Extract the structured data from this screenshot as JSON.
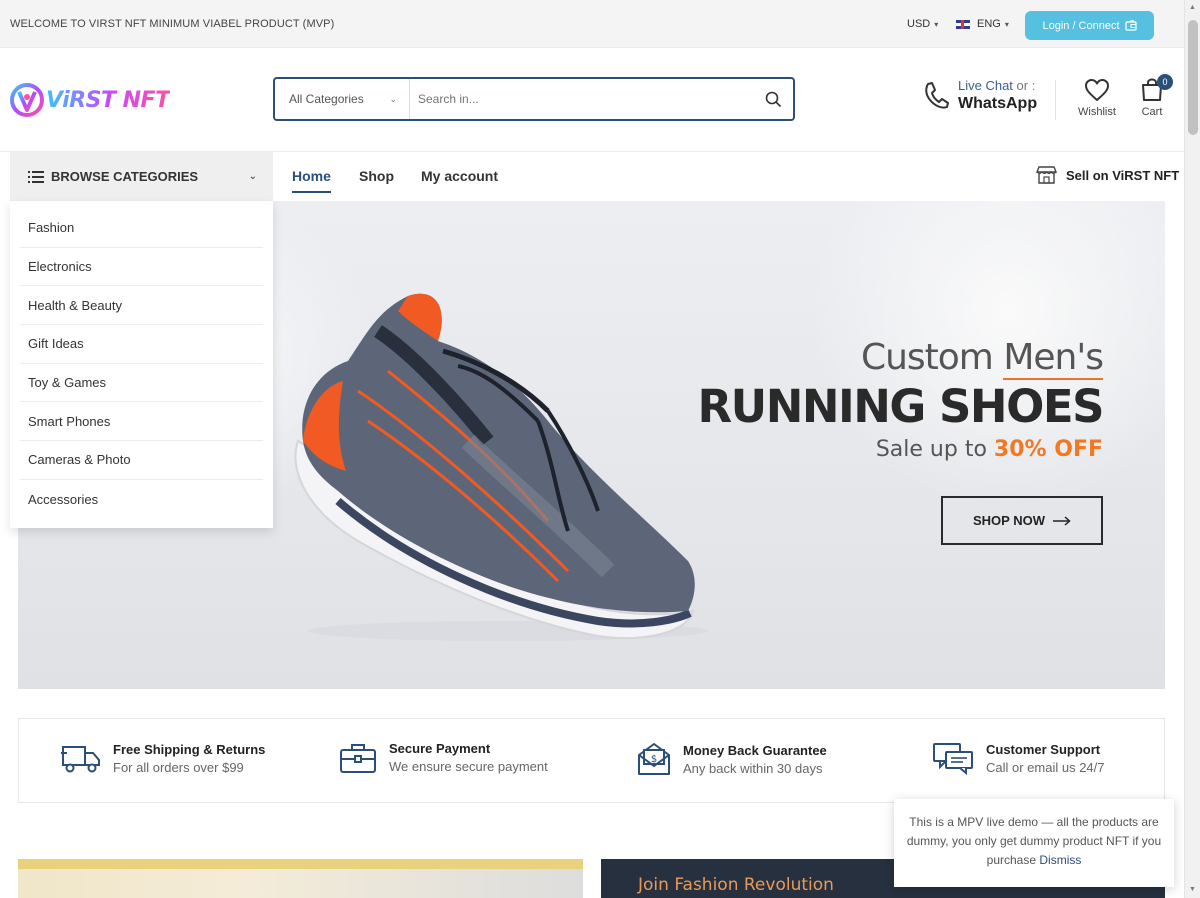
{
  "topbar": {
    "welcome": "WELCOME TO VIRST NFT MINIMUM VIABEL PRODUCT (MVP)",
    "currency": "USD",
    "language": "ENG",
    "login_label": "Login / Connect"
  },
  "header": {
    "logo_text": "ViRST NFT",
    "search": {
      "category": "All Categories",
      "placeholder": "Search in..."
    },
    "live_chat": "Live Chat",
    "or": "or :",
    "whatsapp": "WhatsApp",
    "wishlist_label": "Wishlist",
    "cart_label": "Cart",
    "cart_count": "0"
  },
  "nav": {
    "browse_label": "BROWSE CATEGORIES",
    "links": [
      "Home",
      "Shop",
      "My account"
    ],
    "sell_label": "Sell on ViRST NFT"
  },
  "categories": [
    "Fashion",
    "Electronics",
    "Health & Beauty",
    "Gift Ideas",
    "Toy & Games",
    "Smart Phones",
    "Cameras & Photo",
    "Accessories"
  ],
  "hero": {
    "line1_a": "Custom ",
    "line1_b": "Men's",
    "line2": "RUNNING SHOES",
    "line3_a": "Sale up to ",
    "line3_b": "30% OFF",
    "cta": "SHOP NOW"
  },
  "features": [
    {
      "title": "Free Shipping & Returns",
      "subtitle": "For all orders over $99",
      "icon": "truck-icon"
    },
    {
      "title": "Secure Payment",
      "subtitle": "We ensure secure payment",
      "icon": "briefcase-icon"
    },
    {
      "title": "Money Back Guarantee",
      "subtitle": "Any back within 30 days",
      "icon": "money-envelope-icon"
    },
    {
      "title": "Customer Support",
      "subtitle": "Call or email us 24/7",
      "icon": "chat-icon"
    }
  ],
  "promo": {
    "fashion_title": "Join Fashion Revolution"
  },
  "notice": {
    "text": "This is a MPV live demo — all the products are dummy, you only get dummy product NFT if you purchase",
    "dismiss": "Dismiss"
  },
  "colors": {
    "accent": "#2a4f7a",
    "login": "#56c0e0",
    "orange": "#f07a24"
  }
}
